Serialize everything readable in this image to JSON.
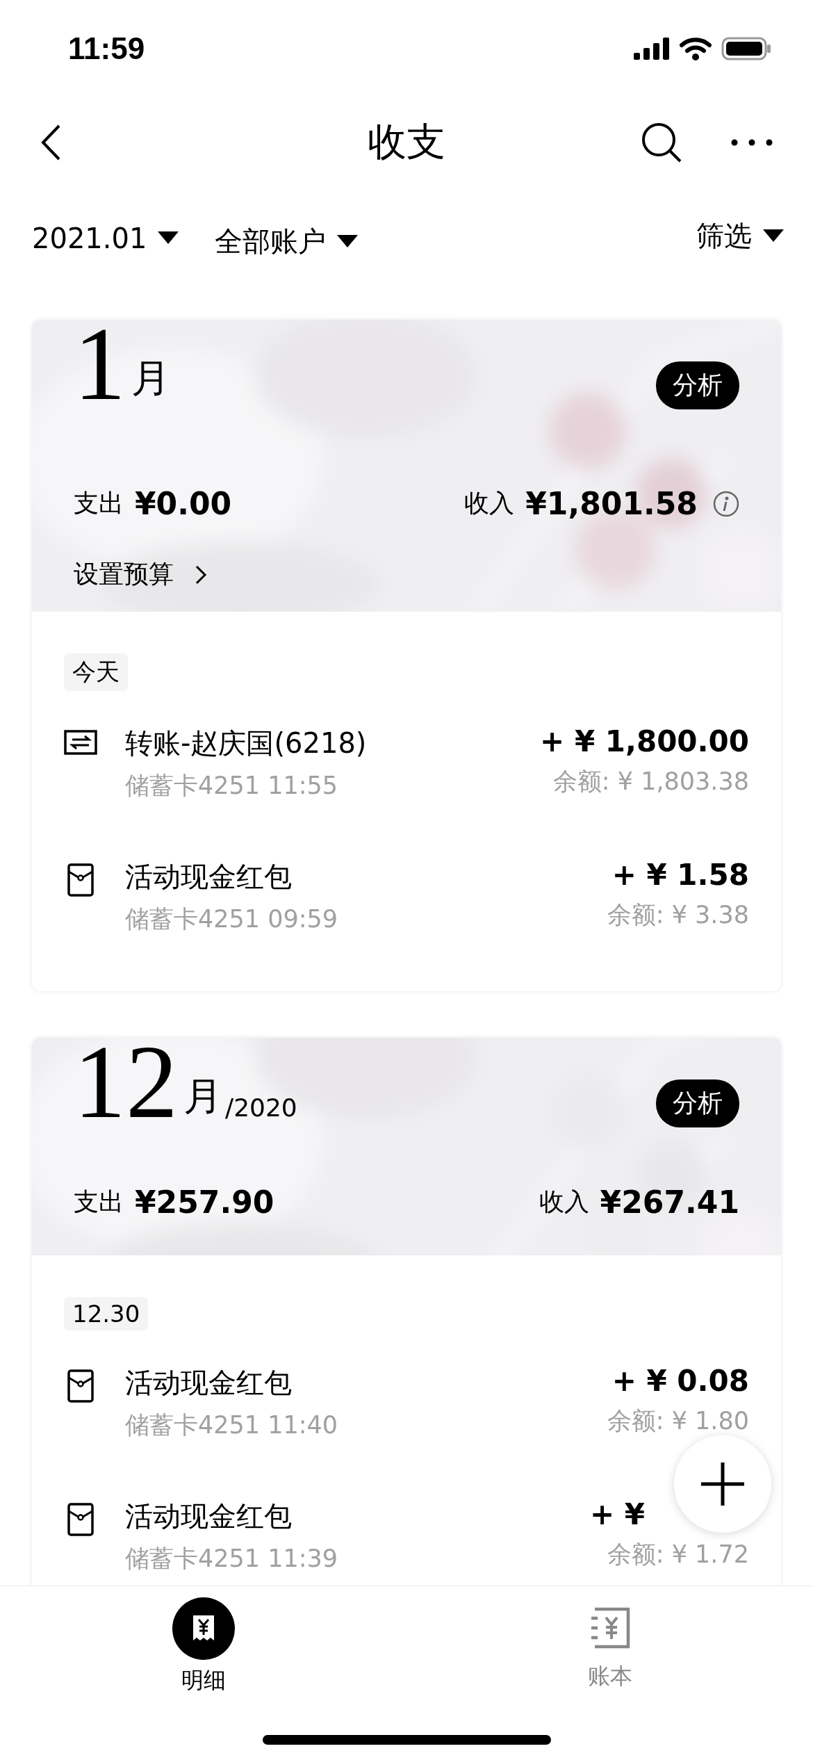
{
  "status_bar": {
    "time": "11:59"
  },
  "nav": {
    "title": "收支"
  },
  "filters": [
    {
      "label": "2021.01"
    },
    {
      "label": "全部账户"
    }
  ],
  "filter_right": {
    "label": "筛选"
  },
  "months": [
    {
      "month": "1",
      "unit": "月",
      "analysis": "分析",
      "expense_label": "支出",
      "expense": "¥0.00",
      "income_label": "收入",
      "income": "¥1,801.58",
      "info": true,
      "budget_link": "设置预算",
      "groups": [
        {
          "date": "今天",
          "items": [
            {
              "kind": "transfer",
              "title": "转账-赵庆国(6218)",
              "detail": "储蓄卡4251 11:55",
              "amount": "+ ¥ 1,800.00",
              "balance": "余额: ¥ 1,803.38"
            },
            {
              "kind": "red_packet",
              "title": "活动现金红包",
              "detail": "储蓄卡4251 09:59",
              "amount": "+ ¥ 1.58",
              "balance": "余额: ¥ 3.38"
            }
          ]
        }
      ]
    },
    {
      "month": "12",
      "unit": "月",
      "year": "/2020",
      "analysis": "分析",
      "expense_label": "支出",
      "expense": "¥257.90",
      "income_label": "收入",
      "income": "¥267.41",
      "info": false,
      "groups": [
        {
          "date": "12.30",
          "items": [
            {
              "kind": "red_packet",
              "title": "活动现金红包",
              "detail": "储蓄卡4251 11:40",
              "amount": "+ ¥ 0.08",
              "balance": "余额: ¥ 1.80"
            },
            {
              "kind": "red_packet",
              "title": "活动现金红包",
              "detail": "储蓄卡4251 11:39",
              "amount": "+ ¥",
              "balance": "余额: ¥ 1.72"
            }
          ]
        }
      ]
    }
  ],
  "tab_bar": [
    {
      "kind": "receipt",
      "label": "明细",
      "selected": true
    },
    {
      "kind": "ledger",
      "label": "账本",
      "selected": false
    }
  ]
}
